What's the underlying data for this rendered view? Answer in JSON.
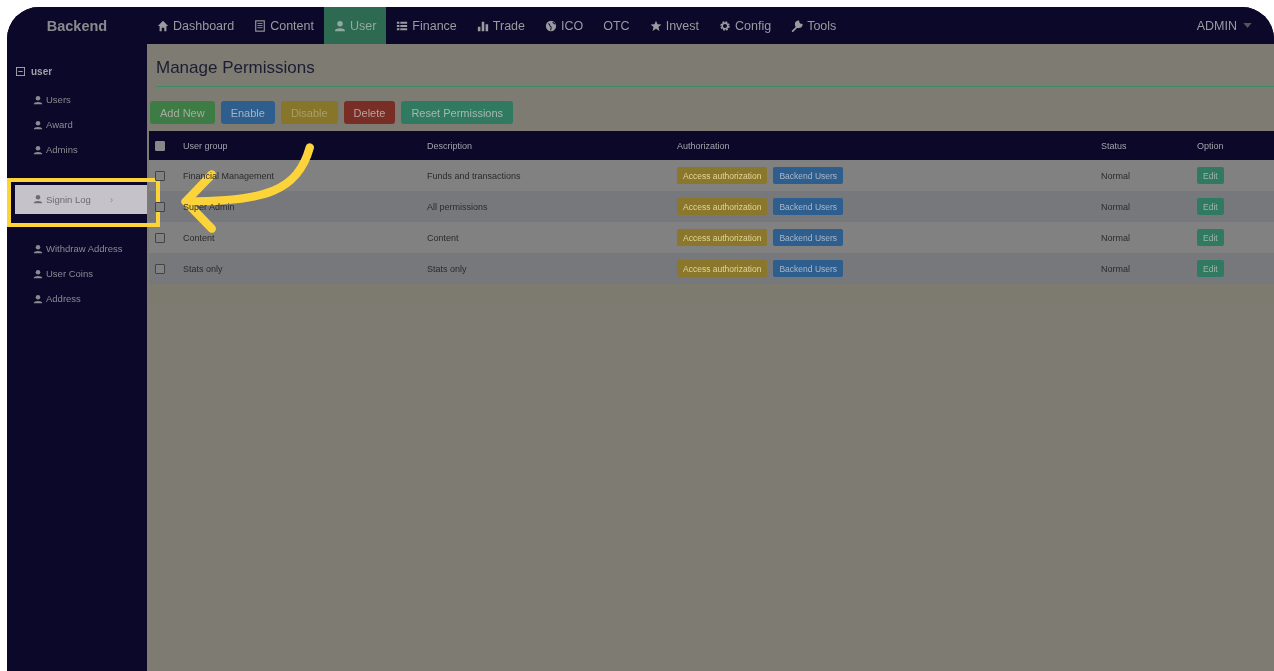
{
  "brand": "Backend",
  "nav": [
    {
      "label": "Dashboard",
      "selected": false
    },
    {
      "label": "Content",
      "selected": false
    },
    {
      "label": "User",
      "selected": true
    },
    {
      "label": "Finance",
      "selected": false
    },
    {
      "label": "Trade",
      "selected": false
    },
    {
      "label": "ICO",
      "selected": false
    },
    {
      "label": "OTC",
      "selected": false
    },
    {
      "label": "Invest",
      "selected": false
    },
    {
      "label": "Config",
      "selected": false
    },
    {
      "label": "Tools",
      "selected": false
    }
  ],
  "account": "ADMIN",
  "sidebar": {
    "group": "user",
    "expanded": true,
    "items": [
      {
        "label": "Users",
        "highlighted": false
      },
      {
        "label": "Award",
        "highlighted": false
      },
      {
        "label": "Admins",
        "highlighted": false
      },
      {
        "label": "Signin Log",
        "highlighted": true,
        "chevron": "›"
      },
      {
        "label": "Withdraw Address",
        "highlighted": false
      },
      {
        "label": "User Coins",
        "highlighted": false
      },
      {
        "label": "Address",
        "highlighted": false
      }
    ]
  },
  "page_title": "Manage Permissions",
  "toolbar": [
    {
      "label": "Add New",
      "kind": "success"
    },
    {
      "label": "Enable",
      "kind": "primary"
    },
    {
      "label": "Disable",
      "kind": "warning"
    },
    {
      "label": "Delete",
      "kind": "danger"
    },
    {
      "label": "Reset Permissions",
      "kind": "teal"
    }
  ],
  "table": {
    "columns": [
      "User group",
      "Description",
      "Authorization",
      "Status",
      "Option"
    ],
    "header_checked": false,
    "rows": [
      {
        "checked": false,
        "user_group": "Financial Management",
        "description": "Funds and transactions",
        "actions": [
          "Access authorization",
          "Backend Users"
        ],
        "status": "Normal",
        "option": "Edit"
      },
      {
        "checked": false,
        "user_group": "Super Admin",
        "description": "All permissions",
        "actions": [
          "Access authorization",
          "Backend Users"
        ],
        "status": "Normal",
        "option": "Edit"
      },
      {
        "checked": false,
        "user_group": "Content",
        "description": "Content",
        "actions": [
          "Access authorization",
          "Backend Users"
        ],
        "status": "Normal",
        "option": "Edit"
      },
      {
        "checked": false,
        "user_group": "Stats only",
        "description": "Stats only",
        "actions": [
          "Access authorization",
          "Backend Users"
        ],
        "status": "Normal",
        "option": "Edit"
      }
    ]
  }
}
